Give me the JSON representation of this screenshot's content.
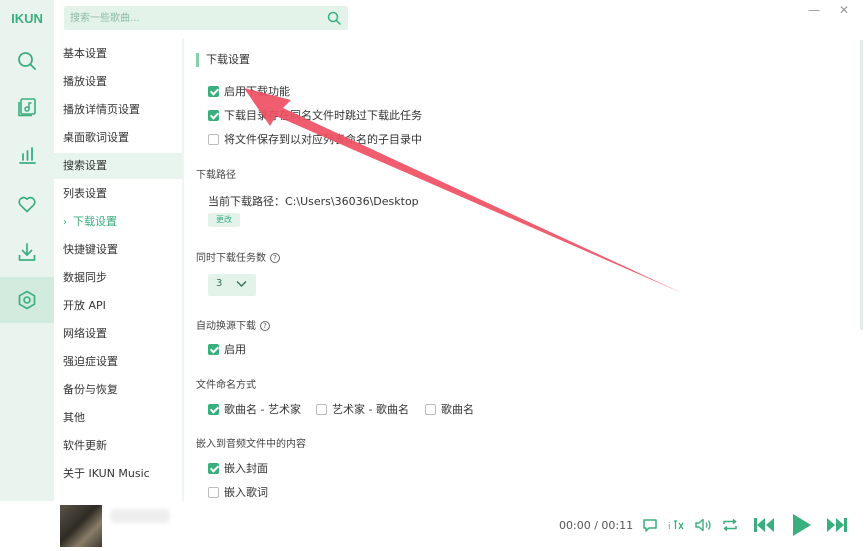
{
  "app": {
    "logo_text": "IKUN",
    "accent_color": "#3aaf7e"
  },
  "search": {
    "placeholder": "搜索一些歌曲...",
    "icon": "search-icon"
  },
  "window_controls": {
    "minimize": "—",
    "close": "✕"
  },
  "nav": [
    {
      "icon": "search-icon",
      "active": false
    },
    {
      "icon": "music-library-icon",
      "active": false
    },
    {
      "icon": "chart-icon",
      "active": false
    },
    {
      "icon": "heart-icon",
      "active": false
    },
    {
      "icon": "download-icon",
      "active": false
    },
    {
      "icon": "settings-icon",
      "active": true
    }
  ],
  "settings_menu": {
    "items": [
      "基本设置",
      "播放设置",
      "播放详情页设置",
      "桌面歌词设置",
      "搜索设置",
      "列表设置",
      "下载设置",
      "快捷键设置",
      "数据同步",
      "开放 API",
      "网络设置",
      "强迫症设置",
      "备份与恢复",
      "其他",
      "软件更新",
      "关于 IKUN Music"
    ],
    "hovered_index": 4,
    "current_index": 6,
    "current_marker": "›"
  },
  "download_settings": {
    "section_title": "下载设置",
    "options": [
      {
        "label": "启用下载功能",
        "checked": true
      },
      {
        "label": "下载目录存在同名文件时跳过下载此任务",
        "checked": true
      },
      {
        "label": "将文件保存到以对应列表命名的子目录中",
        "checked": false
      }
    ],
    "path_group": {
      "label": "下载路径",
      "current_path_label": "当前下载路径：C:\\Users\\36036\\Desktop",
      "change_button": "更改"
    },
    "concurrent_group": {
      "label": "同时下载任务数",
      "help": "?",
      "value": "3"
    },
    "auto_source_group": {
      "label": "自动换源下载",
      "help": "?",
      "option": {
        "label": "启用",
        "checked": true
      }
    },
    "naming_group": {
      "label": "文件命名方式",
      "options": [
        {
          "label": "歌曲名 - 艺术家",
          "checked": true
        },
        {
          "label": "艺术家 - 歌曲名",
          "checked": false
        },
        {
          "label": "歌曲名",
          "checked": false
        }
      ]
    },
    "embed_group": {
      "label": "嵌入到音频文件中的内容",
      "options": [
        {
          "label": "嵌入封面",
          "checked": true
        },
        {
          "label": "嵌入歌词",
          "checked": false
        }
      ]
    }
  },
  "player": {
    "time": "00:00 / 00:11",
    "controls": [
      "comment-icon",
      "lyric-toggle-icon",
      "volume-icon",
      "repeat-icon",
      "previous-icon",
      "play-icon",
      "next-icon"
    ]
  },
  "annotation": {
    "arrow_color": "#ee4f63"
  }
}
